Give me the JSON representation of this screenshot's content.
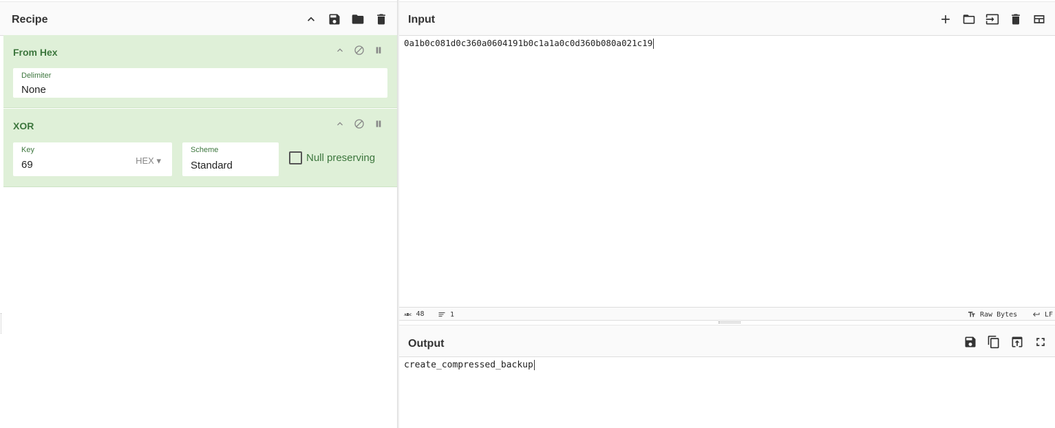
{
  "recipe": {
    "title": "Recipe",
    "tools": [
      "chevron-up-icon",
      "save-icon",
      "folder-icon",
      "trash-icon"
    ],
    "operations": [
      {
        "name": "From Hex",
        "fields": [
          {
            "label": "Delimiter",
            "value": "None"
          }
        ]
      },
      {
        "name": "XOR",
        "fields": [
          {
            "label": "Key",
            "value": "69",
            "dropdown": "HEX"
          },
          {
            "label": "Scheme",
            "value": "Standard"
          }
        ],
        "checkbox": {
          "label": "Null preserving",
          "checked": false
        }
      }
    ]
  },
  "input": {
    "title": "Input",
    "value": "0a1b0c081d0c360a0604191b0c1a1a0c0d360b080a021c19",
    "tools": [
      "plus-icon",
      "folder-icon",
      "import-icon",
      "trash-icon",
      "layout-icon"
    ],
    "status": {
      "length": "48",
      "lines": "1",
      "encoding": "Raw Bytes",
      "eol": "LF"
    }
  },
  "output": {
    "title": "Output",
    "value": "create_compressed_backup",
    "tools": [
      "save-icon",
      "copy-icon",
      "replace-input-icon",
      "fullscreen-icon"
    ]
  },
  "colors": {
    "op_background": "#dff0d8",
    "op_title": "#3c763d"
  }
}
